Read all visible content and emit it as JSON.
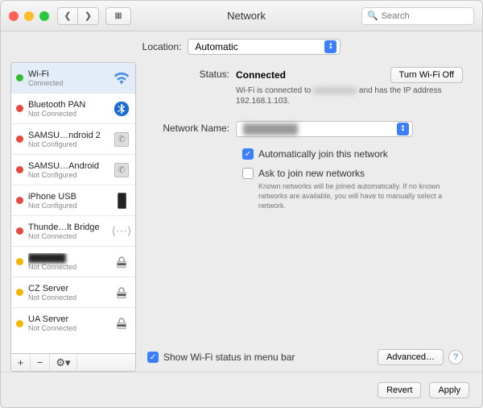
{
  "window": {
    "title": "Network",
    "search_placeholder": "Search"
  },
  "location": {
    "label": "Location:",
    "value": "Automatic"
  },
  "sidebar": {
    "items": [
      {
        "name": "Wi-Fi",
        "sub": "Connected",
        "dot": "green",
        "icon": "wifi"
      },
      {
        "name": "Bluetooth PAN",
        "sub": "Not Connected",
        "dot": "red",
        "icon": "bt"
      },
      {
        "name": "SAMSU…ndroid 2",
        "sub": "Not Configured",
        "dot": "red",
        "icon": "phone"
      },
      {
        "name": "SAMSU…Android",
        "sub": "Not Configured",
        "dot": "red",
        "icon": "phone"
      },
      {
        "name": "iPhone USB",
        "sub": "Not Configured",
        "dot": "red",
        "icon": "iphone"
      },
      {
        "name": "Thunde…lt Bridge",
        "sub": "Not Connected",
        "dot": "red",
        "icon": "cable"
      },
      {
        "name": "██████",
        "sub": "Not Connected",
        "dot": "amber",
        "icon": "lock",
        "blur": true
      },
      {
        "name": "CZ Server",
        "sub": "Not Connected",
        "dot": "amber",
        "icon": "lock"
      },
      {
        "name": "UA Server",
        "sub": "Not Connected",
        "dot": "amber",
        "icon": "lock"
      }
    ],
    "footer": {
      "add": "+",
      "remove": "−",
      "gear": "⚙︎▾"
    }
  },
  "detail": {
    "status_label": "Status:",
    "status_value": "Connected",
    "turn_off": "Turn Wi-Fi Off",
    "substatus_a": "Wi-Fi is connected to ",
    "substatus_b": " and has the IP address 192.168.1.103.",
    "netname_label": "Network Name:",
    "netname_value": "████████",
    "auto_join": "Automatically join this network",
    "ask_join": "Ask to join new networks",
    "ask_help": "Known networks will be joined automatically. If no known networks are available, you will have to manually select a network.",
    "show_status": "Show Wi-Fi status in menu bar",
    "advanced": "Advanced…",
    "help": "?"
  },
  "footer": {
    "revert": "Revert",
    "apply": "Apply"
  }
}
